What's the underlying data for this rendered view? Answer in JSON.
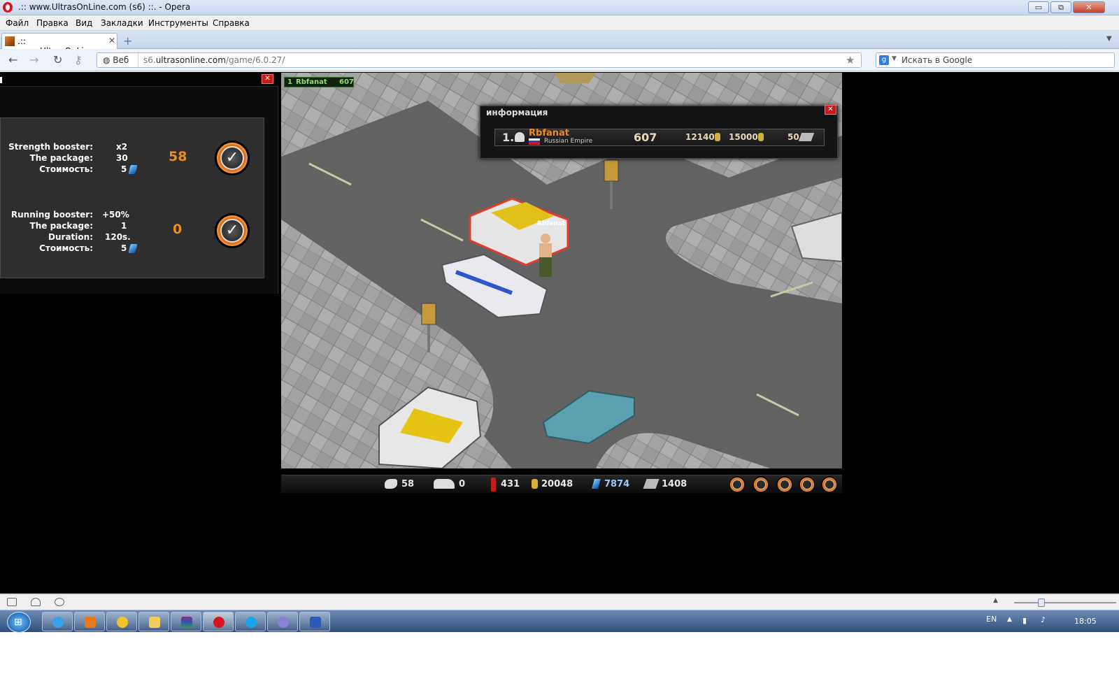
{
  "window": {
    "title": ".:: www.UltrasOnLine.com (s6) ::. - Opera",
    "minimize": "▭",
    "restore": "⧉",
    "close": "✕"
  },
  "menu": [
    "Файл",
    "Правка",
    "Вид",
    "Закладки",
    "Инструменты",
    "Справка"
  ],
  "tab": {
    "title": ".:: www.UltrasOnLine.c...",
    "close": "✕"
  },
  "address": {
    "security_label": "Веб",
    "url_host_prefix": "s6.",
    "url_host_main": "ultrasonline.com",
    "url_path": "/game/6.0.27/",
    "search_placeholder": "Искать в Google",
    "search_engine_letter": "g"
  },
  "boosters": [
    {
      "rows": [
        {
          "label": "Strength booster:",
          "value": "x2"
        },
        {
          "label": "The package:",
          "value": "30"
        },
        {
          "label": "Стоимость:",
          "value": "5"
        }
      ],
      "count": "58"
    },
    {
      "rows": [
        {
          "label": "Running booster:",
          "value": "+50%"
        },
        {
          "label": "The package:",
          "value": "1"
        },
        {
          "label": "Duration:",
          "value": "120s."
        },
        {
          "label": "Стоимость:",
          "value": "5"
        }
      ],
      "count": "0"
    }
  ],
  "game": {
    "player_badge": {
      "rank": "1",
      "name": "Rbfanat",
      "score": "607"
    },
    "player_tag": "Rbfanat",
    "info_popup": {
      "title": "информация",
      "rank": "1.",
      "name": "Rbfanat",
      "country": "Russian Empire",
      "score": "607",
      "coins": "12140",
      "coins2": "15000",
      "tickets": "50"
    },
    "bottom_bar": {
      "strength": "58",
      "speed": "0",
      "bottles": "431",
      "coins": "20048",
      "gems": "7874",
      "tickets": "1408"
    }
  },
  "colors": {
    "accent_orange": "#ef8c1c",
    "close_red": "#c21d1d",
    "name_orange": "#f08a1c"
  },
  "taskbar": {
    "lang": "EN",
    "time": "18:05",
    "apps": [
      "ie-icon",
      "illustrator-icon",
      "chrome-icon",
      "explorer-icon",
      "winrar-icon",
      "opera-icon",
      "skype-icon",
      "app-icon",
      "word-icon"
    ]
  }
}
